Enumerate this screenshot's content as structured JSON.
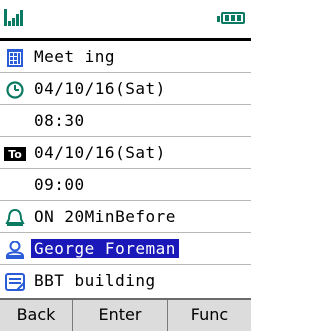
{
  "status": {
    "signal_icon": "signal-bars-icon",
    "battery_icon": "battery-full-icon"
  },
  "rows": [
    {
      "icon": "calendar-grid-icon",
      "text": "Meet ing"
    },
    {
      "icon": "clock-icon",
      "text": "04/10/16(Sat)"
    },
    {
      "icon": "",
      "text": "08:30"
    },
    {
      "icon": "to-icon",
      "text": "04/10/16(Sat)"
    },
    {
      "icon": "",
      "text": "09:00"
    },
    {
      "icon": "alarm-bell-icon",
      "text": "ON  20MinBefore"
    },
    {
      "icon": "person-icon",
      "text": "George Foreman"
    },
    {
      "icon": "memo-icon",
      "text": "BBT building"
    }
  ],
  "to_icon_label": "To",
  "softkeys": {
    "left": "Back",
    "center": "Enter",
    "right": "Func"
  },
  "colors": {
    "accent": "#1a18b8",
    "icon_blue": "#2a5cd8",
    "icon_green": "#0a7a62"
  }
}
